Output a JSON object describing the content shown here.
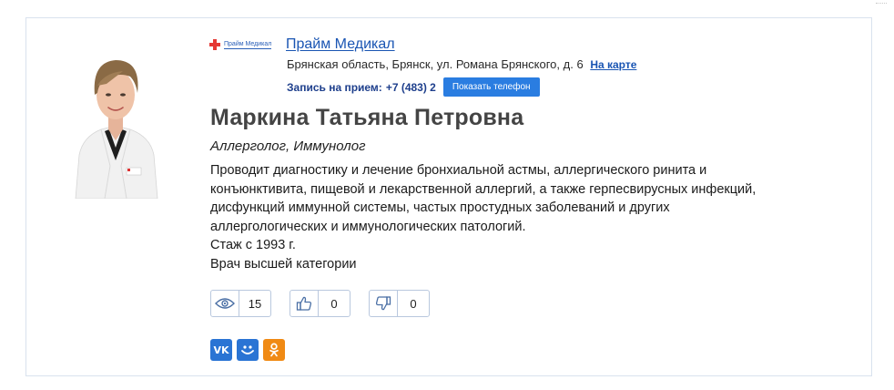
{
  "clinic": {
    "logo_text": "Прайм Медикал",
    "name": "Прайм Медикал",
    "address": "Брянская область, Брянск, ул. Романа Брянского, д. 6",
    "map_link": "На карте",
    "phone_label": "Запись на прием:",
    "phone_number": "+7 (483) 2",
    "show_phone_button": "Показать телефон"
  },
  "doctor": {
    "name": "Маркина Татьяна Петровна",
    "specialty": "Аллерголог, Иммунолог",
    "description_lines": [
      "Проводит диагностику и лечение бронхиальной астмы, аллергического ринита и",
      "конъюнктивита, пищевой и лекарственной аллергий, а также герпесвирусных инфекций,",
      "дисфункций иммунной системы, частых простудных заболеваний и других",
      "аллергологических и иммунологических патологий.",
      "Стаж с 1993 г.",
      "Врач высшей категории"
    ]
  },
  "stats": {
    "views": "15",
    "likes": "0",
    "dislikes": "0"
  },
  "icons": {
    "views": "eye-icon",
    "likes": "thumbs-up-icon",
    "dislikes": "thumbs-down-icon",
    "logo": "red-cross-icon"
  },
  "social": [
    {
      "name": "vk",
      "label": "VK",
      "color": "#2a74d4"
    },
    {
      "name": "moi-mir",
      "label": "Мой Мир",
      "color": "#2a74d4"
    },
    {
      "name": "odnoklassniki",
      "label": "Одноклассники",
      "color": "#f08a14"
    }
  ],
  "colors": {
    "link": "#1a55b3",
    "button": "#2a7de1",
    "border": "#d9e2ee",
    "logo_red": "#e53935"
  }
}
